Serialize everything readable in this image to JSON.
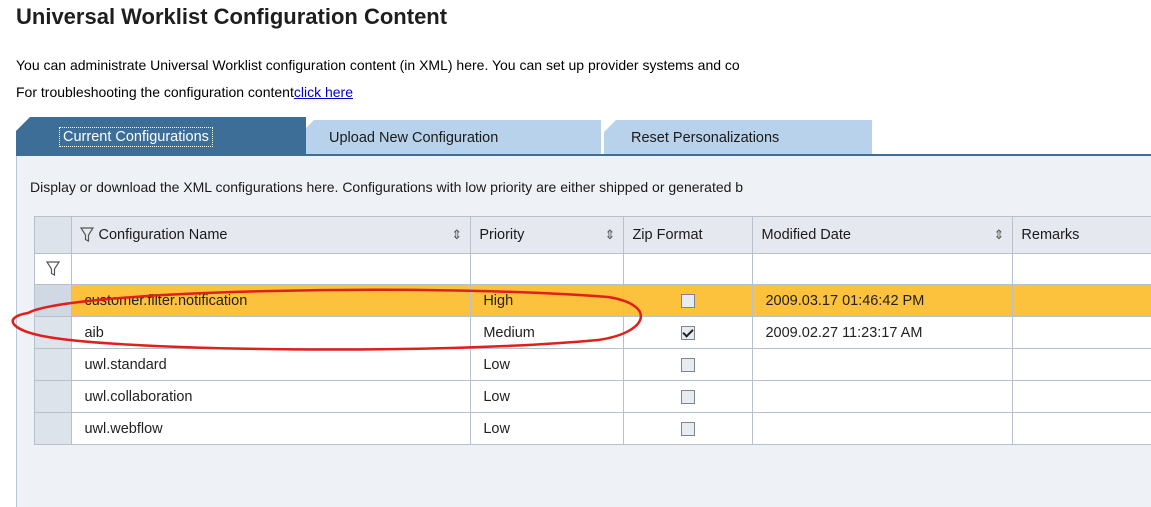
{
  "page": {
    "title": "Universal Worklist Configuration Content",
    "description": "You can administrate Universal Worklist configuration content (in XML) here. You can set up provider systems and co",
    "troubleshoot_text": "For troubleshooting the configuration content",
    "troubleshoot_link": "click here"
  },
  "tabs": [
    {
      "label": "Current Configurations",
      "active": true
    },
    {
      "label": "Upload New Configuration",
      "active": false
    },
    {
      "label": "Reset Personalizations",
      "active": false
    }
  ],
  "panel": {
    "description": "Display or download the XML configurations here. Configurations with low priority are either shipped or generated b"
  },
  "table": {
    "columns": [
      "Configuration Name",
      "Priority",
      "Zip Format",
      "Modified Date",
      "Remarks"
    ],
    "rows": [
      {
        "name": "customer.filter.notification",
        "priority": "High",
        "zip": false,
        "modified": "2009.03.17 01:46:42 PM",
        "remarks": "",
        "selected": true
      },
      {
        "name": "aib",
        "priority": "Medium",
        "zip": true,
        "modified": "2009.02.27 11:23:17 AM",
        "remarks": "",
        "selected": false
      },
      {
        "name": "uwl.standard",
        "priority": "Low",
        "zip": false,
        "modified": "",
        "remarks": "",
        "selected": false
      },
      {
        "name": "uwl.collaboration",
        "priority": "Low",
        "zip": false,
        "modified": "",
        "remarks": "",
        "selected": false
      },
      {
        "name": "uwl.webflow",
        "priority": "Low",
        "zip": false,
        "modified": "",
        "remarks": "",
        "selected": false
      }
    ]
  },
  "colors": {
    "accent": "#3c6e98",
    "tab_inactive": "#b9d2eb",
    "selected_row": "#fcc13d",
    "annotation": "#e0201c"
  },
  "icons": {
    "filter": "filter-icon",
    "sort": "sort-icon",
    "checkbox": "checkbox"
  }
}
